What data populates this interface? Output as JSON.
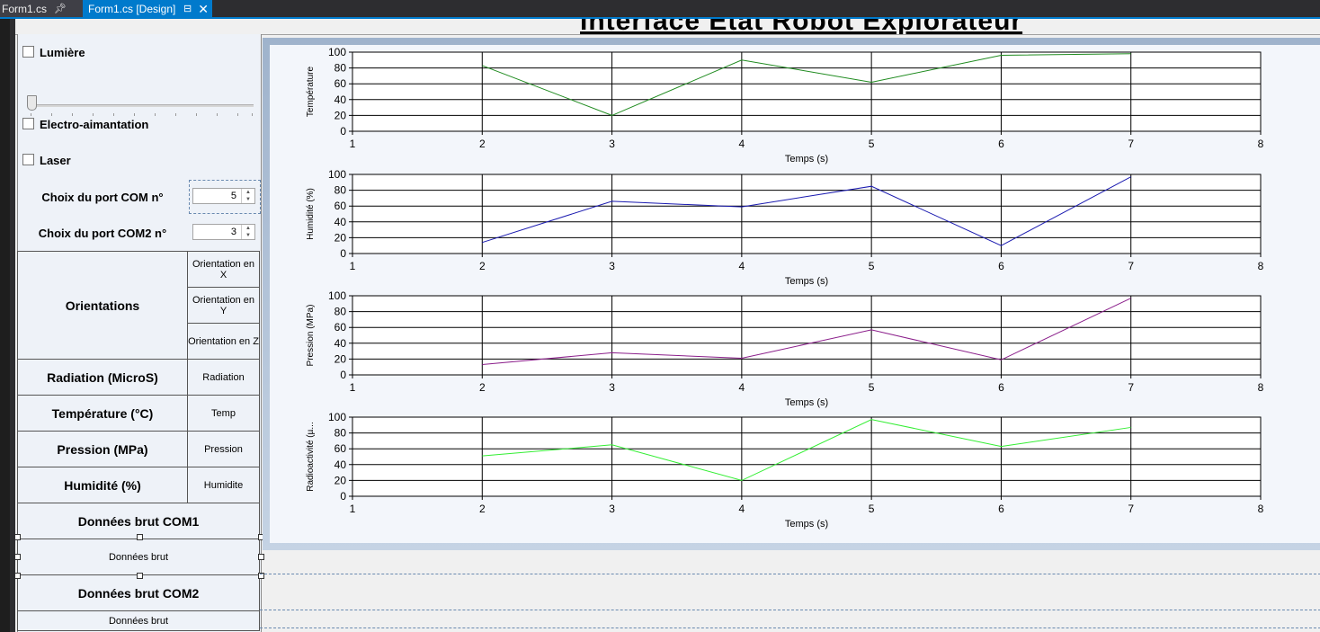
{
  "tabs": [
    {
      "label": "Form1.cs"
    },
    {
      "label": "Form1.cs [Design]"
    }
  ],
  "form_title": "Interface Etat Robot Explorateur",
  "controls": {
    "lumiere": "Lumière",
    "electro": "Electro-aimantation",
    "laser": "Laser",
    "com_label": "Choix du port COM n°",
    "com_value": "5",
    "com2_label": "Choix du port COM2 n°",
    "com2_value": "3"
  },
  "grid": {
    "orientations": "Orientations",
    "orient_x": "Orientation en X",
    "orient_y": "Orientation en Y",
    "orient_z": "Orientation en Z",
    "radiation_label": "Radiation (MicroS)",
    "radiation_value": "Radiation",
    "temperature_label": "Température (°C)",
    "temperature_value": "Temp",
    "pression_label": "Pression (MPa)",
    "pression_value": "Pression",
    "humidite_label": "Humidité (%)",
    "humidite_value": "Humidite",
    "com1_header": "Données brut COM1",
    "com1_value": "Données brut",
    "com2_header": "Données brut COM2",
    "com2_value": "Données brut"
  },
  "colors": {
    "temperature": "#1f8b1f",
    "humidite": "#1a1ab0",
    "pression": "#8b1f8b",
    "radioactivite": "#33ee33"
  },
  "chart_data": [
    {
      "type": "line",
      "ylabel": "Température",
      "xlabel": "Temps (s)",
      "xlim": [
        1,
        8
      ],
      "ylim": [
        0,
        100
      ],
      "x": [
        2,
        3,
        4,
        5,
        6,
        7
      ],
      "values": [
        83,
        20,
        90,
        62,
        96,
        98
      ]
    },
    {
      "type": "line",
      "ylabel": "Humidité (%)",
      "xlabel": "Temps (s)",
      "xlim": [
        1,
        8
      ],
      "ylim": [
        0,
        100
      ],
      "x": [
        2,
        3,
        4,
        5,
        6,
        7
      ],
      "values": [
        14,
        66,
        59,
        85,
        10,
        97
      ]
    },
    {
      "type": "line",
      "ylabel": "Pression (MPa)",
      "xlabel": "Temps (s)",
      "xlim": [
        1,
        8
      ],
      "ylim": [
        0,
        100
      ],
      "x": [
        2,
        3,
        4,
        5,
        6,
        7
      ],
      "values": [
        13,
        28,
        21,
        57,
        19,
        97
      ]
    },
    {
      "type": "line",
      "ylabel": "Radioactivité (µ...",
      "xlabel": "Temps (s)",
      "xlim": [
        1,
        8
      ],
      "ylim": [
        0,
        100
      ],
      "x": [
        2,
        3,
        4,
        5,
        6,
        7
      ],
      "values": [
        51,
        65,
        20,
        97,
        63,
        87
      ]
    }
  ]
}
